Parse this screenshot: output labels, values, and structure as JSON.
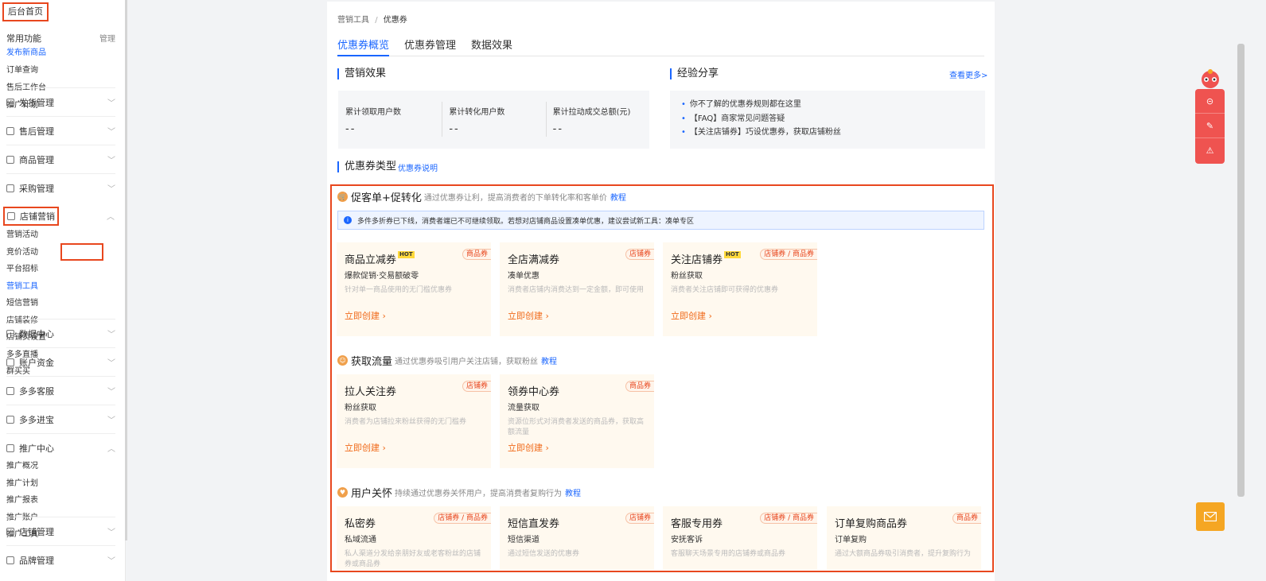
{
  "sidebar": {
    "home": "后台首页",
    "common_title": "常用功能",
    "common_manage": "管理",
    "common_items": [
      "发布新商品",
      "订单查询",
      "售后工作台",
      "推广计划"
    ],
    "sections": [
      "发货管理",
      "售后管理",
      "商品管理",
      "采购管理",
      "店铺营销",
      "数据中心",
      "账户资金",
      "多多客服",
      "多多进宝",
      "推广中心",
      "店铺管理",
      "品牌管理"
    ],
    "marketing_items": [
      "营销活动",
      "竞价活动",
      "平台招标",
      "营销工具",
      "短信营销",
      "店铺装修",
      "店铺页设置",
      "多多直播",
      "群买买"
    ],
    "promo_items": [
      "推广概况",
      "推广计划",
      "推广报表",
      "推广账户",
      "推广工具"
    ]
  },
  "breadcrumb": {
    "parent": "营销工具",
    "sep": "/",
    "current": "优惠券"
  },
  "tabs": [
    "优惠券概览",
    "优惠券管理",
    "数据效果"
  ],
  "effect": {
    "title": "营销效果",
    "stats": [
      {
        "label": "累计领取用户数",
        "value": "--"
      },
      {
        "label": "累计转化用户数",
        "value": "--"
      },
      {
        "label": "累计拉动成交总额(元)",
        "value": "--"
      }
    ]
  },
  "share": {
    "title": "经验分享",
    "more": "查看更多>",
    "items": [
      "你不了解的优惠券规则都在这里",
      "【FAQ】商家常见问题答疑",
      "【关注店铺券】巧设优惠券，获取店铺粉丝"
    ]
  },
  "types": {
    "title": "优惠券类型",
    "link": "优惠券说明"
  },
  "notice": "多件多折券已下线，消费者端已不可继续领取。若想对店铺商品设置凑单优惠，建议尝试新工具：凑单专区",
  "groups": [
    {
      "name": "促客单+促转化",
      "desc": "通过优惠券让利，提高消费者的下单转化率和客单价",
      "link": "教程",
      "cards": [
        {
          "name": "商品立减券",
          "hot": "HOT",
          "tag": "商品券",
          "sub": "爆款促销·交易额破零",
          "desc": "针对单一商品使用的无门槛优惠券",
          "action": "立即创建 ›"
        },
        {
          "name": "全店满减券",
          "hot": "",
          "tag": "店铺券",
          "sub": "凑单优惠",
          "desc": "消费者店铺内消费达到一定金额，即可使用",
          "action": "立即创建 ›"
        },
        {
          "name": "关注店铺券",
          "hot": "HOT",
          "tag": "店铺券 / 商品券",
          "sub": "粉丝获取",
          "desc": "消费者关注店铺即可获得的优惠券",
          "action": "立即创建 ›"
        }
      ]
    },
    {
      "name": "获取流量",
      "desc": "通过优惠券吸引用户关注店铺，获取粉丝",
      "link": "教程",
      "cards": [
        {
          "name": "拉人关注券",
          "hot": "",
          "tag": "店铺券",
          "sub": "粉丝获取",
          "desc": "消费者为店铺拉来粉丝获得的无门槛券",
          "action": "立即创建 ›"
        },
        {
          "name": "领券中心券",
          "hot": "",
          "tag": "商品券",
          "sub": "流量获取",
          "desc": "资源位形式对消费者发送的商品券，获取高额流量",
          "action": "立即创建 ›"
        }
      ]
    },
    {
      "name": "用户关怀",
      "desc": "持续通过优惠券关怀用户，提高消费者复购行为",
      "link": "教程",
      "cards": [
        {
          "name": "私密券",
          "hot": "",
          "tag": "店铺券 / 商品券",
          "sub": "私域流通",
          "desc": "私人渠道分发给亲朋好友或老客粉丝的店铺券或商品券",
          "action": ""
        },
        {
          "name": "短信直发券",
          "hot": "",
          "tag": "店铺券",
          "sub": "短信渠道",
          "desc": "通过短信发送的优惠券",
          "action": ""
        },
        {
          "name": "客服专用券",
          "hot": "",
          "tag": "店铺券 / 商品券",
          "sub": "安抚客诉",
          "desc": "客服聊天场景专用的店铺券或商品券",
          "action": ""
        },
        {
          "name": "订单复购商品券",
          "hot": "",
          "tag": "商品券",
          "sub": "订单复购",
          "desc": "通过大额商品券吸引消费者，提升复购行为",
          "action": ""
        }
      ]
    }
  ],
  "colors": {
    "accent": "#1a66ff",
    "highlight_border": "#e8471e",
    "action": "#f06a1a",
    "card_bg": "#fff9ef"
  }
}
